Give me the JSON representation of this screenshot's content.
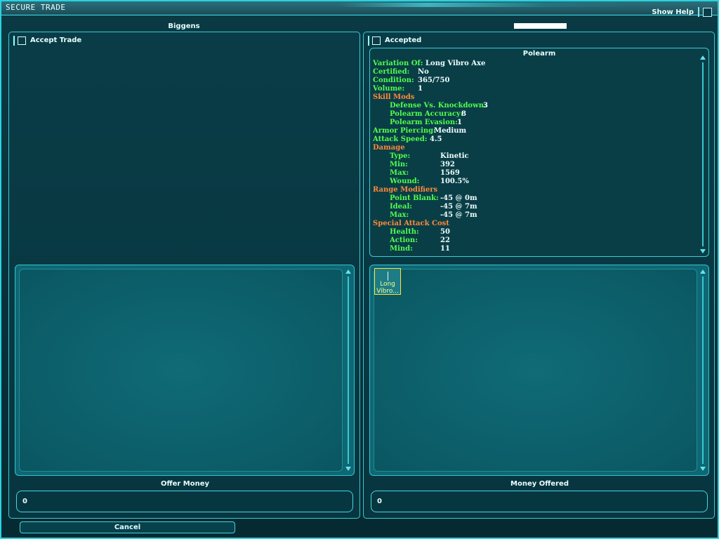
{
  "window": {
    "title": "SECURE TRADE",
    "help_label": "Show Help"
  },
  "left_panel": {
    "header": "Biggens",
    "accept_label": "Accept Trade",
    "money_label": "Offer Money",
    "money_value": "0"
  },
  "right_panel": {
    "header": "",
    "accepted_label": "Accepted",
    "money_label": "Money Offered",
    "money_value": "0"
  },
  "item_tooltip": {
    "title": "Polearm",
    "variation_key": "Variation Of:",
    "variation_val": "Long Vibro Axe",
    "certified_key": "Certified:",
    "certified_val": "No",
    "condition_key": "Condition:",
    "condition_val": "365/750",
    "volume_key": "Volume:",
    "volume_val": "1",
    "skill_mods_heading": "Skill Mods",
    "defense_key": "Defense Vs. Knockdown:",
    "defense_val": "3",
    "accuracy_key": "Polearm Accuracy:",
    "accuracy_val": "8",
    "evasion_key": "Polearm Evasion:",
    "evasion_val": "1",
    "armor_key": "Armor Piercing:",
    "armor_val": "Medium",
    "speed_key": "Attack Speed:",
    "speed_val": "4.5",
    "damage_heading": "Damage",
    "type_key": "Type:",
    "type_val": "Kinetic",
    "min_key": "Min:",
    "min_val": "392",
    "max_key": "Max:",
    "max_val": "1569",
    "wound_key": "Wound:",
    "wound_val": "100.5%",
    "range_heading": "Range Modifiers",
    "pb_key": "Point Blank:",
    "pb_val": "-45 @  0m",
    "ideal_key": "Ideal:",
    "ideal_val": "-45 @  7m",
    "rmax_key": "Max:",
    "rmax_val": "-45 @  7m",
    "sac_heading": "Special Attack Cost",
    "health_key": "Health:",
    "health_val": "50",
    "action_key": "Action:",
    "action_val": "22",
    "mind_key": "Mind:",
    "mind_val": "11"
  },
  "offered_item": {
    "label": "Long Vibro..."
  },
  "buttons": {
    "cancel": "Cancel"
  },
  "colors": {
    "accent": "#2ad3e0",
    "key_green": "#52ff4c",
    "heading_orange": "#ff8a3a",
    "item_border": "#ffe33a"
  }
}
